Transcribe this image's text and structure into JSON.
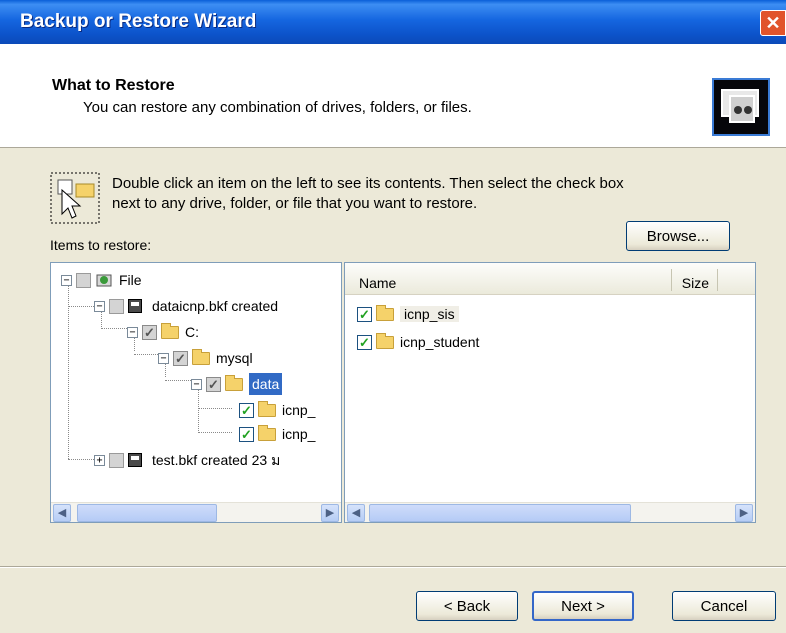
{
  "window": {
    "title": "Backup or Restore Wizard",
    "close_glyph": "✕"
  },
  "header": {
    "title": "What to Restore",
    "subtitle": "You can restore any combination of drives, folders, or files.",
    "icon": "backup-tape-icon"
  },
  "instructions": {
    "icon": "folder-cursor-icon",
    "text": "Double click an item on the left to see its contents. Then select the check box next to any drive, folder, or file that you want to restore."
  },
  "browse_button": "Browse...",
  "items_label": "Items to restore:",
  "tree": {
    "root": {
      "label": "File",
      "expander": "−"
    },
    "media1": {
      "label": "dataicnp.bkf created",
      "expander": "−"
    },
    "drive": {
      "label": "C:",
      "expander": "−"
    },
    "mysql": {
      "label": "mysql",
      "expander": "−"
    },
    "data": {
      "label": "data",
      "expander": "−"
    },
    "child1": {
      "label": "icnp_"
    },
    "child2": {
      "label": "icnp_"
    },
    "media2": {
      "label": "test.bkf created 23 ม",
      "expander": "+"
    }
  },
  "list": {
    "columns": {
      "name": "Name",
      "size": "Size"
    },
    "rows": [
      {
        "label": "icnp_sis",
        "checked": true
      },
      {
        "label": "icnp_student",
        "checked": true
      }
    ]
  },
  "buttons": {
    "back": "< Back",
    "next": "Next >",
    "cancel": "Cancel"
  },
  "check_glyph": "✓"
}
